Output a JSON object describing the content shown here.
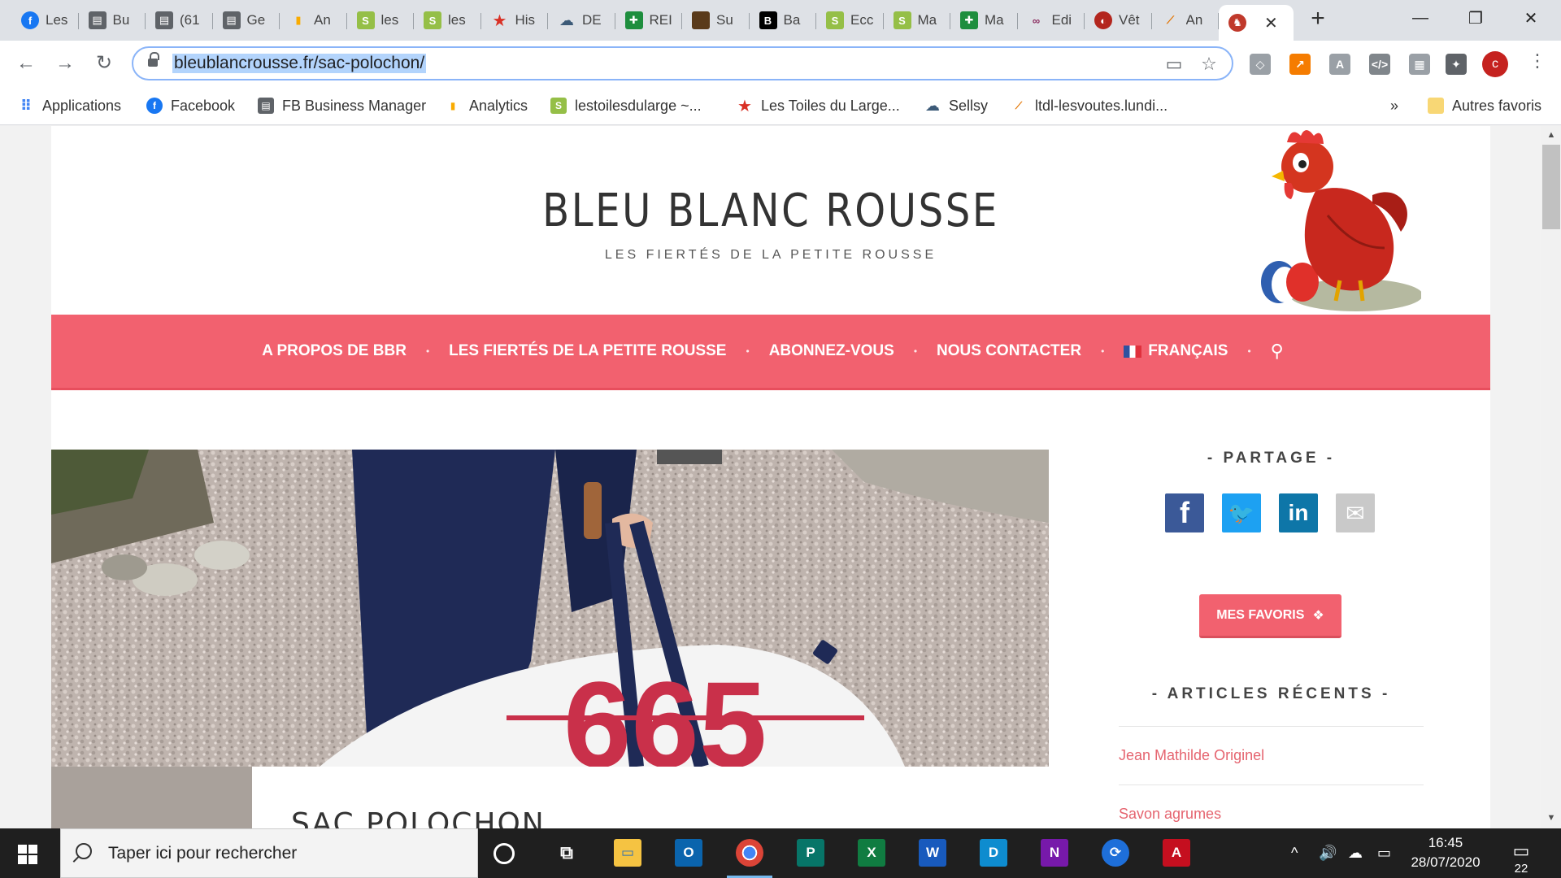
{
  "browser": {
    "tabs": [
      {
        "title": "Les",
        "icon": "facebook-icon",
        "color": "#1877f2"
      },
      {
        "title": "Bu",
        "icon": "page-icon",
        "color": "#5f6368"
      },
      {
        "title": "(61",
        "icon": "page-icon",
        "color": "#5f6368"
      },
      {
        "title": "Ge",
        "icon": "page-icon",
        "color": "#5f6368"
      },
      {
        "title": "An",
        "icon": "analytics-icon",
        "color": "#f9ab00"
      },
      {
        "title": "les",
        "icon": "shopify-icon",
        "color": "#95bf47"
      },
      {
        "title": "les",
        "icon": "shopify-icon",
        "color": "#95bf47"
      },
      {
        "title": "His",
        "icon": "star-icon",
        "color": "#d93025"
      },
      {
        "title": "DE",
        "icon": "cloud-icon",
        "color": "#3c5a78"
      },
      {
        "title": "REI",
        "icon": "plus-icon",
        "color": "#1e8e3e"
      },
      {
        "title": "Su",
        "icon": "book-icon",
        "color": "#5a3a1a"
      },
      {
        "title": "Ba",
        "icon": "b-icon",
        "color": "#000000"
      },
      {
        "title": "Ecc",
        "icon": "shopify-icon",
        "color": "#95bf47"
      },
      {
        "title": "Ma",
        "icon": "shopify-icon",
        "color": "#95bf47"
      },
      {
        "title": "Ma",
        "icon": "plus-icon",
        "color": "#1e8e3e"
      },
      {
        "title": "Edi",
        "icon": "link-icon",
        "color": "#8a2a5e"
      },
      {
        "title": "Vêt",
        "icon": "globe-icon",
        "color": "#b3261e"
      },
      {
        "title": "An",
        "icon": "feather-icon",
        "color": "#e37400"
      }
    ],
    "active_tab_icon": "rooster-icon",
    "new_tab_label": "+",
    "window_controls": {
      "minimize": "—",
      "restore": "❐",
      "close": "✕"
    },
    "url": "bleublancrousse.fr/sac-polochon/",
    "profile_initial": "c"
  },
  "bookmarks": [
    {
      "label": "Applications",
      "icon": "apps-grid-icon",
      "color": "#4285f4"
    },
    {
      "label": "Facebook",
      "icon": "facebook-icon",
      "color": "#1877f2"
    },
    {
      "label": "FB Business Manager",
      "icon": "page-icon",
      "color": "#5f6368"
    },
    {
      "label": "Analytics",
      "icon": "analytics-icon",
      "color": "#f9ab00"
    },
    {
      "label": "lestoilesdularge ~...",
      "icon": "shopify-icon",
      "color": "#95bf47"
    },
    {
      "label": "Les Toiles du Large...",
      "icon": "star-icon",
      "color": "#d93025"
    },
    {
      "label": "Sellsy",
      "icon": "cloud-icon",
      "color": "#3c5a78"
    },
    {
      "label": "ltdl-lesvoutes.lundi...",
      "icon": "feather-icon",
      "color": "#e37400"
    }
  ],
  "bookmarks_overflow": "»",
  "other_bookmarks": "Autres favoris",
  "site": {
    "title": "BLEU BLANC ROUSSE",
    "tagline": "LES FIERTÉS DE LA PETITE ROUSSE",
    "nav": [
      "A PROPOS DE BBR",
      "LES FIERTÉS DE LA PETITE ROUSSE",
      "ABONNEZ-VOUS",
      "NOUS CONTACTER",
      "FRANÇAIS"
    ],
    "nav_separator": "•",
    "accent": "#f2616f",
    "hero_bag_number": "665",
    "article_title": "SAC POLOCHON",
    "sidebar": {
      "share_title": "- PARTAGE -",
      "share_buttons": [
        {
          "icon": "facebook-icon",
          "color": "#3b5998"
        },
        {
          "icon": "twitter-icon",
          "color": "#1da1f2"
        },
        {
          "icon": "linkedin-icon",
          "color": "#0e76a8"
        },
        {
          "icon": "email-icon",
          "color": "#bdbdbd"
        }
      ],
      "favorites_button": "MES FAVORIS",
      "recent_title": "- ARTICLES RÉCENTS -",
      "recent_posts": [
        "Jean Mathilde Originel",
        "Savon agrumes"
      ]
    }
  },
  "taskbar": {
    "search_placeholder": "Taper ici pour rechercher",
    "time": "16:45",
    "date": "28/07/2020",
    "notification_count": "22",
    "apps": [
      {
        "icon": "cortana-icon",
        "color": "#1f1f1f"
      },
      {
        "icon": "task-view-icon",
        "color": "#1f1f1f"
      },
      {
        "icon": "file-explorer-icon",
        "color": "#f5c342"
      },
      {
        "icon": "outlook-icon",
        "color": "#0a64ad"
      },
      {
        "icon": "chrome-icon",
        "color": "#db4437"
      },
      {
        "icon": "publisher-icon",
        "color": "#077568"
      },
      {
        "icon": "excel-icon",
        "color": "#107c41"
      },
      {
        "icon": "word-icon",
        "color": "#185abd"
      },
      {
        "icon": "dashlane-icon",
        "color": "#0e8ccf"
      },
      {
        "icon": "onenote-icon",
        "color": "#7719aa"
      },
      {
        "icon": "sync-icon",
        "color": "#1e6fd9"
      },
      {
        "icon": "acrobat-icon",
        "color": "#c50f1f"
      }
    ]
  }
}
